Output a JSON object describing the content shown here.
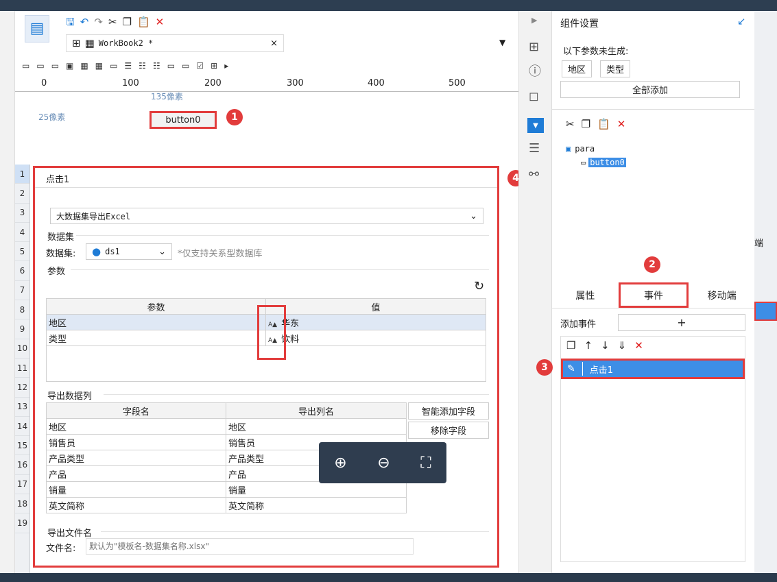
{
  "toolbar": {
    "tab_label": "WorkBook2 *",
    "tab_close": "×"
  },
  "ruler": {
    "marks": [
      "0",
      "100",
      "200",
      "300",
      "400",
      "500"
    ]
  },
  "canvas": {
    "width_label": "135像素",
    "height_label": "25像素",
    "button_label": "button0"
  },
  "dialog": {
    "title": "点击1",
    "action": "大数据集导出Excel",
    "dataset_section": "数据集",
    "dataset_label": "数据集:",
    "dataset_value": "ds1",
    "dataset_note": "*仅支持关系型数据库",
    "params_section": "参数",
    "params_header_param": "参数",
    "params_header_value": "值",
    "params": [
      {
        "name": "地区",
        "value": "华东"
      },
      {
        "name": "类型",
        "value": "饮料"
      }
    ],
    "export_cols_section": "导出数据列",
    "col_header_field": "字段名",
    "col_header_export": "导出列名",
    "columns": [
      {
        "field": "地区",
        "export": "地区"
      },
      {
        "field": "销售员",
        "export": "销售员"
      },
      {
        "field": "产品类型",
        "export": "产品类型"
      },
      {
        "field": "产品",
        "export": "产品"
      },
      {
        "field": "销量",
        "export": "销量"
      },
      {
        "field": "英文简称",
        "export": "英文简称"
      }
    ],
    "smart_add_button": "智能添加字段",
    "remove_button": "移除字段",
    "filename_section": "导出文件名",
    "filename_label": "文件名:",
    "filename_placeholder": "默认为\"模板名-数据集名称.xlsx\""
  },
  "row_numbers": [
    "1",
    "2",
    "3",
    "4",
    "5",
    "6",
    "7",
    "8",
    "9",
    "10",
    "11",
    "12",
    "13",
    "14",
    "15",
    "16",
    "17",
    "18",
    "19"
  ],
  "badges": [
    "1",
    "2",
    "3",
    "4"
  ],
  "right": {
    "title": "组件设置",
    "params_not_generated": "以下参数未生成:",
    "param_chips": [
      "地区",
      "类型"
    ],
    "add_all_button": "全部添加",
    "tree_root": "para",
    "tree_child": "button0",
    "tabs": [
      "属性",
      "事件",
      "移动端"
    ],
    "add_event_label": "添加事件",
    "add_event_button": "+",
    "event_item": "点击1"
  },
  "farright": {
    "label": "端"
  },
  "colors": {
    "accent_red": "#e23c3c",
    "selection_blue": "#3d8ee6"
  }
}
